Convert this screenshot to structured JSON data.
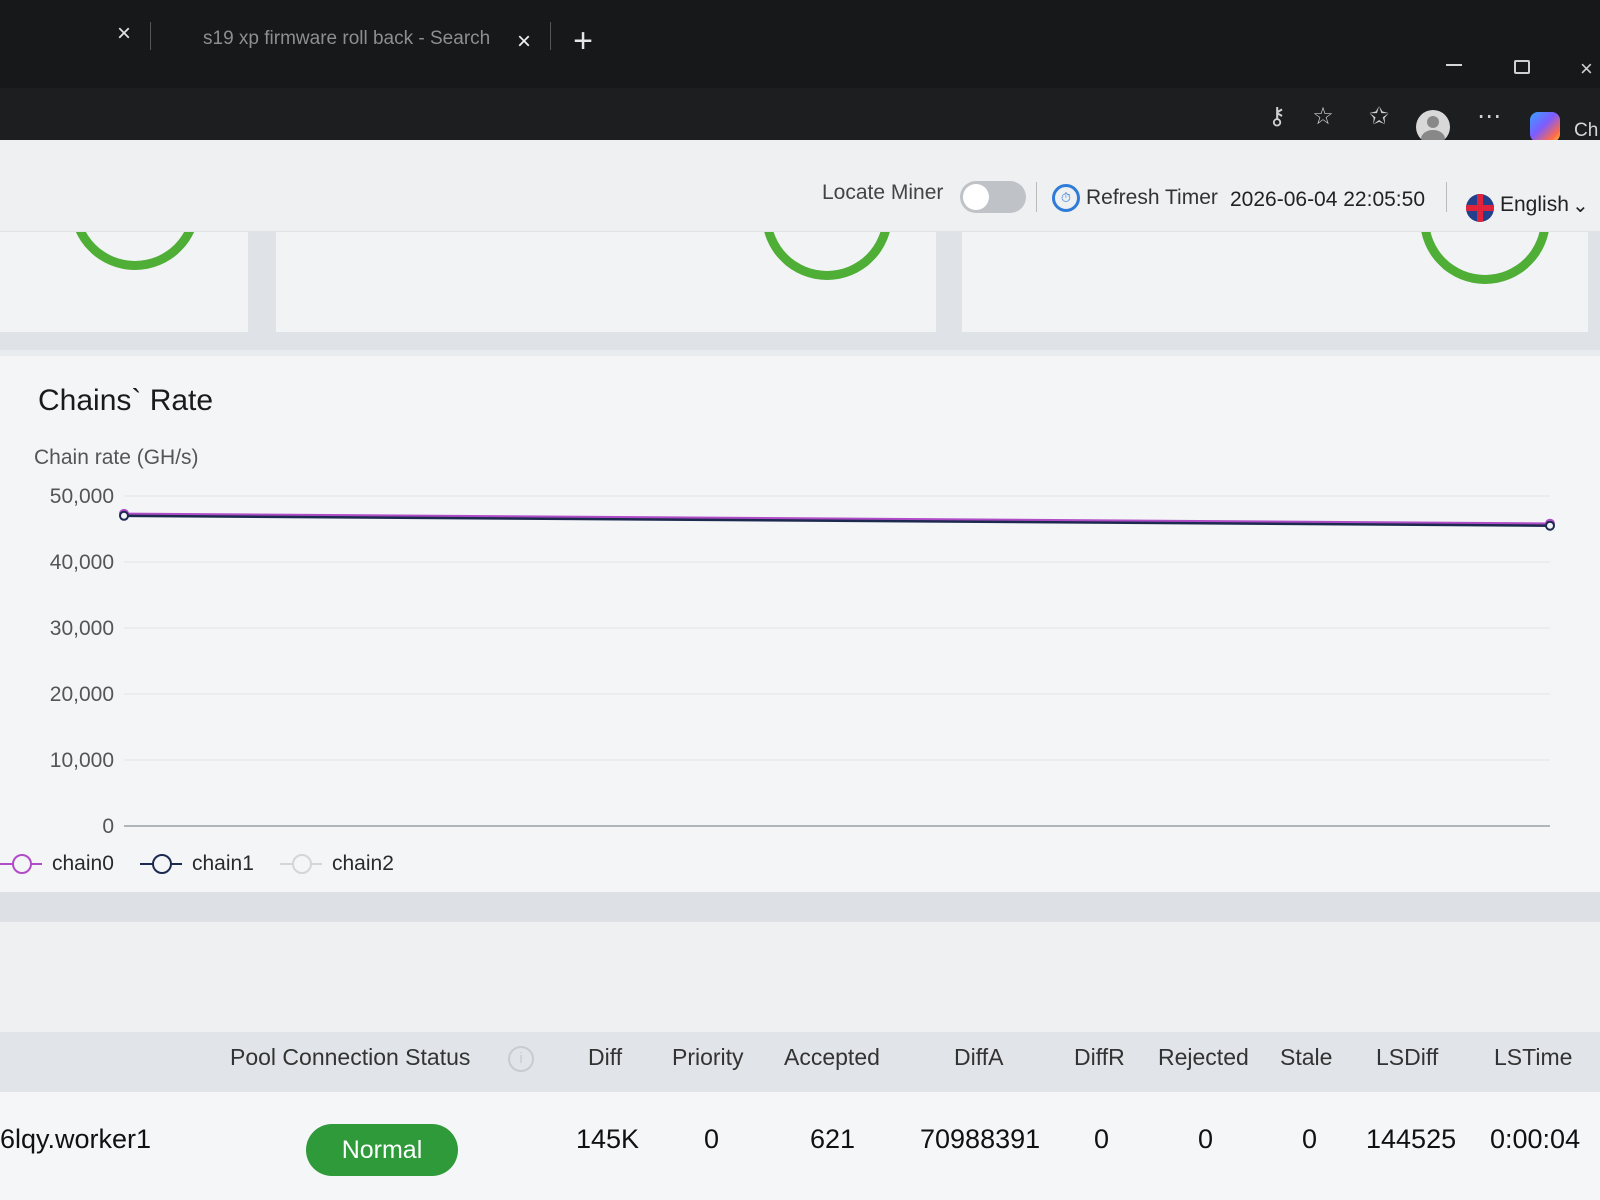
{
  "browser": {
    "tabs": [
      {
        "title": ""
      },
      {
        "title": "s19 xp firmware roll back - Search"
      }
    ],
    "copilot_label": "Ch"
  },
  "header": {
    "locate_label": "Locate Miner",
    "locate_on": false,
    "refresh_label": "Refresh Timer",
    "refresh_value": "2026-06-04 22:05:50",
    "language": "English"
  },
  "chart_panel": {
    "title": "Chains` Rate"
  },
  "chart_data": {
    "type": "line",
    "ylabel": "Chain rate (GH/s)",
    "xlabel": "",
    "ylim": [
      0,
      50000
    ],
    "yticks": [
      "50,000",
      "40,000",
      "30,000",
      "20,000",
      "10,000",
      "0"
    ],
    "grid": true,
    "legend_position": "bottom-left",
    "x": [
      0,
      1
    ],
    "series": [
      {
        "name": "chain0",
        "color": "#b04cc7",
        "values": [
          47300,
          45800
        ]
      },
      {
        "name": "chain1",
        "color": "#1d2a50",
        "values": [
          47000,
          45500
        ]
      },
      {
        "name": "chain2",
        "color": "#d2d5d9",
        "values": [
          null,
          null
        ]
      }
    ]
  },
  "pool_table": {
    "headers": [
      "Pool Connection Status",
      "Diff",
      "Priority",
      "Accepted",
      "DiffA",
      "DiffR",
      "Rejected",
      "Stale",
      "LSDiff",
      "LSTime"
    ],
    "rows": [
      {
        "worker": "6lqy.worker1",
        "status": "Normal",
        "diff": "145K",
        "priority": "0",
        "accepted": "621",
        "diffa": "70988391",
        "diffr": "0",
        "rejected": "0",
        "stale": "0",
        "lsdiff": "144525",
        "lstime": "0:00:04"
      }
    ]
  },
  "colors": {
    "accent_green": "#4fae36",
    "status_normal": "#2e9a3a",
    "timer_blue": "#2f7bd8"
  }
}
